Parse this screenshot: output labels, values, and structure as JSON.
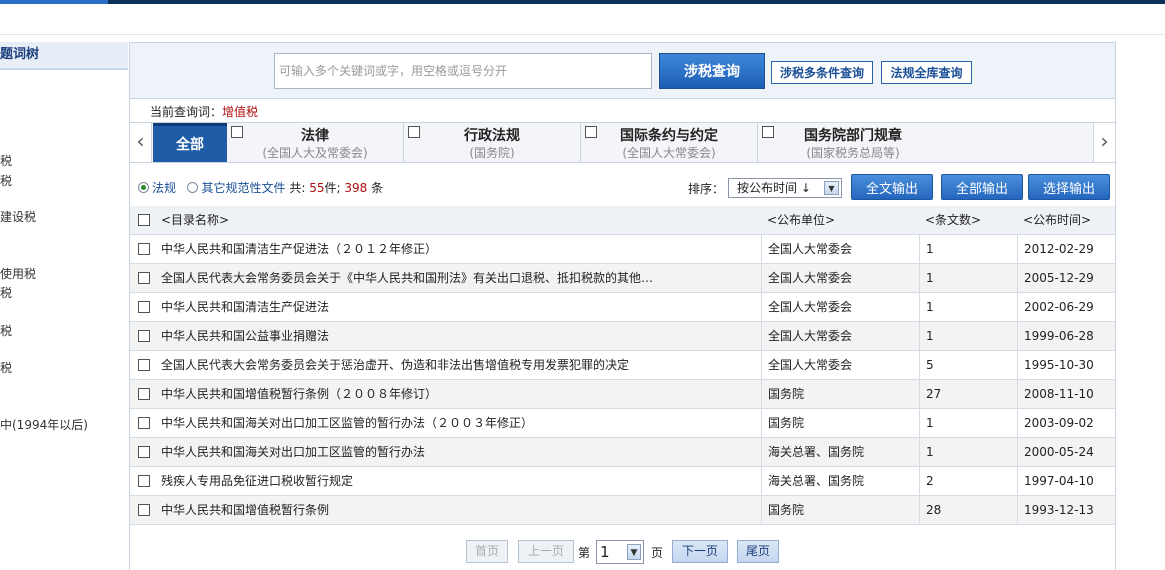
{
  "tree": {
    "title": "题词树",
    "items": [
      "税",
      "税",
      "建设税",
      "使用税",
      "税",
      "税",
      "税",
      "中(1994年以后)"
    ]
  },
  "search": {
    "placeholder": "可输入多个关键词或字，用空格或逗号分开",
    "search_label": "涉税查询",
    "multi_label": "涉税多条件查询",
    "full_label": "法规全库查询"
  },
  "query": {
    "prefix": "当前查询词：",
    "keyword": "增值税"
  },
  "categories": {
    "all": "全部",
    "items": [
      {
        "title": "法律",
        "sub": "(全国人大及常委会)"
      },
      {
        "title": "行政法规",
        "sub": "(国务院)"
      },
      {
        "title": "国际条约与约定",
        "sub": "(全国人大常委会)"
      },
      {
        "title": "国务院部门规章",
        "sub": "(国家税务总局等)"
      }
    ]
  },
  "filter": {
    "opt1": "法规",
    "opt2": "其它规范性文件",
    "total_prefix": "共:",
    "count1": "55",
    "unit1": "件;",
    "count2": "398",
    "unit2": "条"
  },
  "sort": {
    "label": "排序：",
    "selected": "按公布时间 ↓"
  },
  "actions": {
    "full_export": "全文输出",
    "all_export": "全部输出",
    "select_export": "选择输出"
  },
  "table": {
    "headers": {
      "name": "<目录名称>",
      "unit": "<公布单位>",
      "count": "<条文数>",
      "date": "<公布时间>"
    },
    "rows": [
      {
        "name": "中华人民共和国清洁生产促进法（２０１２年修正）",
        "unit": "全国人大常委会",
        "count": "1",
        "date": "2012-02-29"
      },
      {
        "name": "全国人民代表大会常务委员会关于《中华人民共和国刑法》有关出口退税、抵扣税款的其他…",
        "unit": "全国人大常委会",
        "count": "1",
        "date": "2005-12-29"
      },
      {
        "name": "中华人民共和国清洁生产促进法",
        "unit": "全国人大常委会",
        "count": "1",
        "date": "2002-06-29"
      },
      {
        "name": "中华人民共和国公益事业捐赠法",
        "unit": "全国人大常委会",
        "count": "1",
        "date": "1999-06-28"
      },
      {
        "name": "全国人民代表大会常务委员会关于惩治虚开、伪造和非法出售增值税专用发票犯罪的决定",
        "unit": "全国人大常委会",
        "count": "5",
        "date": "1995-10-30"
      },
      {
        "name": "中华人民共和国增值税暂行条例（２００８年修订）",
        "unit": "国务院",
        "count": "27",
        "date": "2008-11-10"
      },
      {
        "name": "中华人民共和国海关对出口加工区监管的暂行办法（２００３年修正）",
        "unit": "国务院",
        "count": "1",
        "date": "2003-09-02"
      },
      {
        "name": "中华人民共和国海关对出口加工区监管的暂行办法",
        "unit": "海关总署、国务院",
        "count": "1",
        "date": "2000-05-24"
      },
      {
        "name": "残疾人专用品免征进口税收暂行规定",
        "unit": "海关总署、国务院",
        "count": "2",
        "date": "1997-04-10"
      },
      {
        "name": "中华人民共和国增值税暂行条例",
        "unit": "国务院",
        "count": "28",
        "date": "1993-12-13"
      }
    ]
  },
  "pager": {
    "first": "首页",
    "prev": "上一页",
    "page_prefix": "第",
    "page": "1",
    "page_suffix": "页",
    "next": "下一页",
    "last": "尾页"
  }
}
